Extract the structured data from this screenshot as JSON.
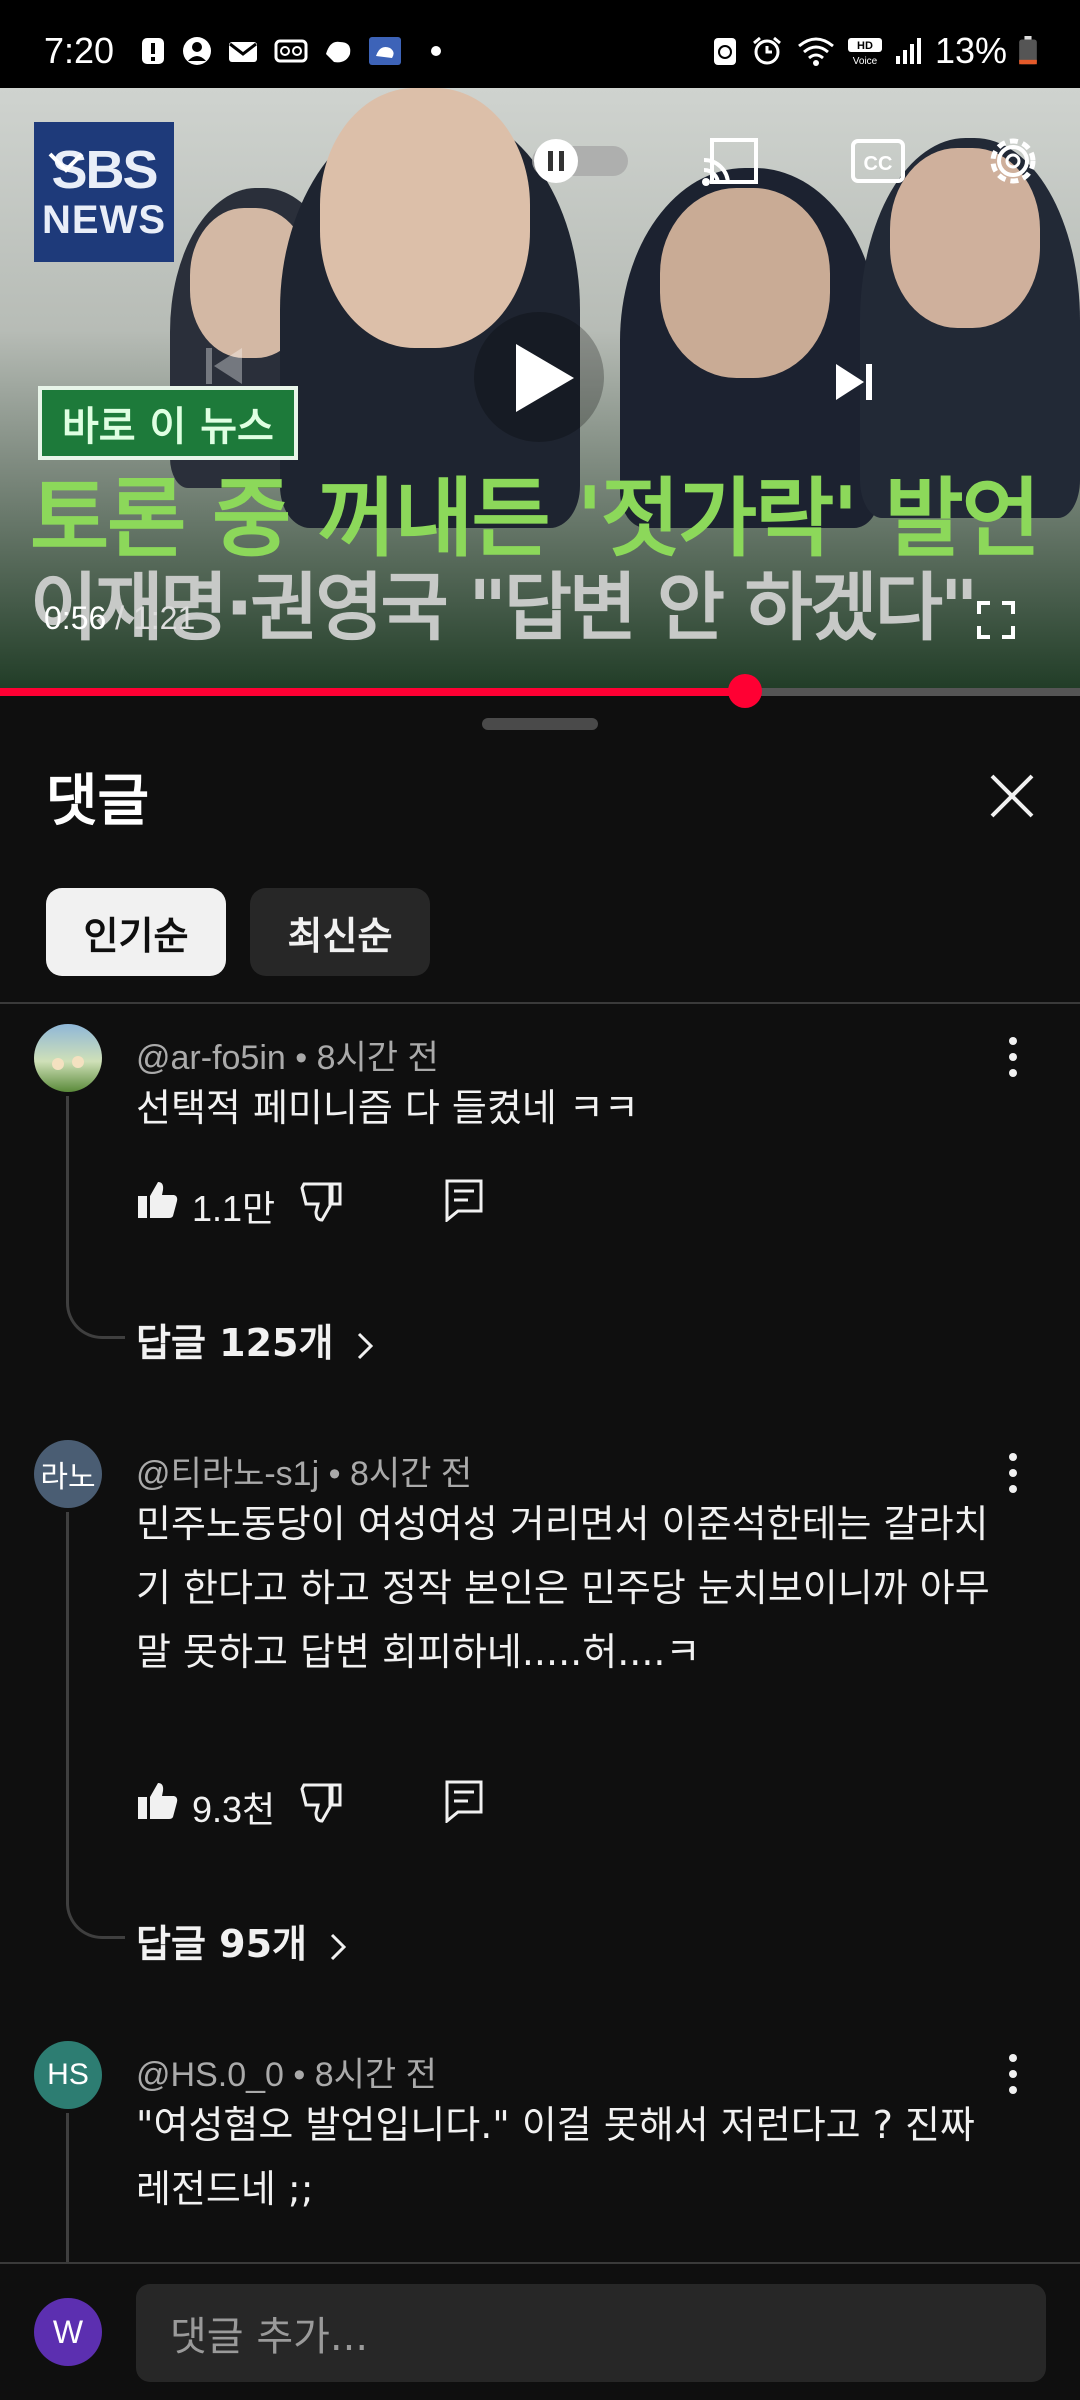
{
  "status_bar": {
    "time": "7:20",
    "battery": "13%"
  },
  "video": {
    "logo_line1": "SBS",
    "logo_line2": "NEWS",
    "tag": "바로 이 뉴스",
    "headline1": "토론 중 꺼내든 '젓가락' 발언",
    "headline2": "이재명·권영국 \"답변 안 하겠다\"",
    "current_time": "0:56",
    "total_time": " / 1:21",
    "progress_fraction": 0.69
  },
  "comments": {
    "title": "댓글",
    "sort_chips": [
      "인기순",
      "최신순"
    ],
    "items": [
      {
        "author": "@ar-fo5in",
        "time": "8시간 전",
        "text": "선택적 페미니즘 다 들켰네 ㅋㅋ",
        "likes": "1.1만",
        "replies": "답글 125개"
      },
      {
        "author": "@티라노-s1j",
        "time": "8시간 전",
        "avatar_text": "라노",
        "text": "민주노동당이 여성여성 거리면서 이준석한테는 갈라치기 한다고 하고 정작 본인은 민주당 눈치보이니까 아무말 못하고 답변 회피하네.....허....ㅋ",
        "likes": "9.3천",
        "replies": "답글 95개"
      },
      {
        "author": "@HS.0_0",
        "time": "8시간 전",
        "avatar_text": "HS",
        "text": "\"여성혐오 발언입니다.\" 이걸 못해서 저런다고 ? 진짜 레전드네 ;;"
      }
    ]
  },
  "composer": {
    "avatar_text": "W",
    "placeholder": "댓글 추가..."
  },
  "colors": {
    "accent": "#ff0033",
    "background": "#0f0f0f"
  }
}
